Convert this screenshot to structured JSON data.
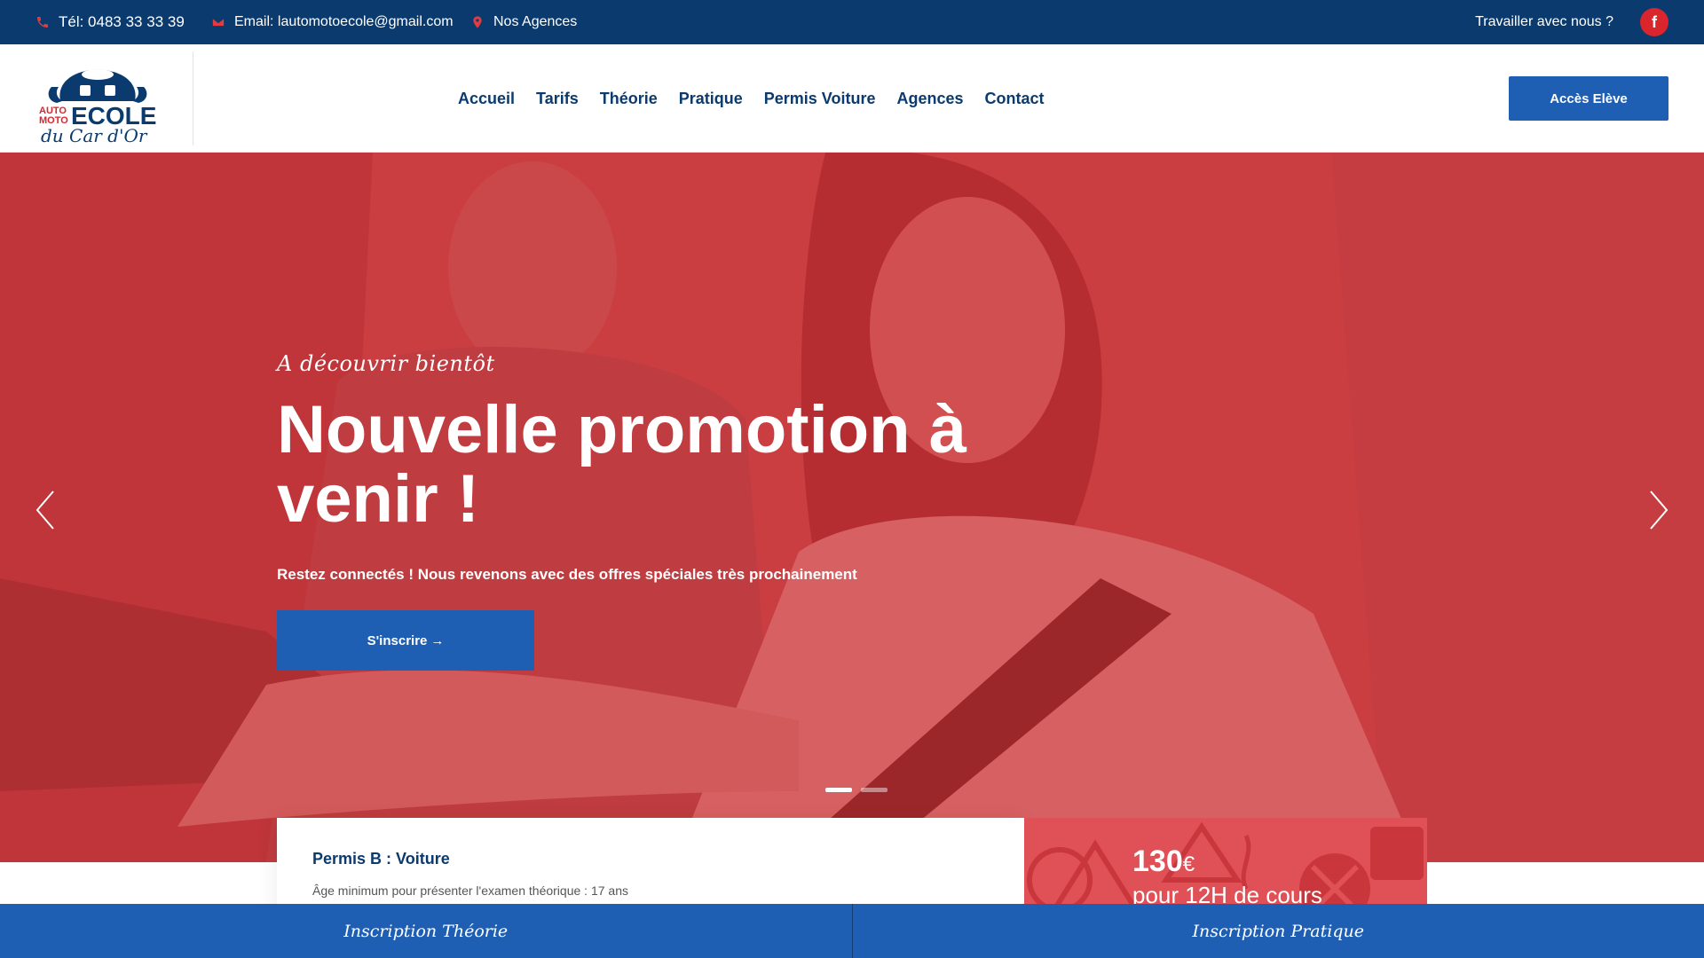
{
  "topbar": {
    "phone": "Tél: 0483 33 33 39",
    "email": "Email: lautomotoecole@gmail.com",
    "agencies": "Nos Agences",
    "work_with_us": "Travailler avec nous ?",
    "facebook_label": "f"
  },
  "logo": {
    "line1": "AUTO",
    "line2": "MOTO",
    "big": "ECOLE",
    "script": "du Car d'Or"
  },
  "nav": {
    "items": [
      "Accueil",
      "Tarifs",
      "Théorie",
      "Pratique",
      "Permis Voiture",
      "Agences",
      "Contact"
    ],
    "cta": "Accès Elève"
  },
  "hero": {
    "tagline": "A découvrir bientôt",
    "title": "Nouvelle promotion à venir !",
    "subtitle": "Restez connectés ! Nous revenons avec des offres spéciales très prochainement",
    "button": "S'inscrire",
    "button_arrow": "→",
    "slide_count": 2,
    "active_slide": 1
  },
  "card": {
    "title": "Permis B : Voiture",
    "text": "Âge minimum pour présenter l'examen théorique : 17 ans"
  },
  "price": {
    "amount": "130",
    "currency": "€",
    "detail": "pour 12H de cours"
  },
  "bottombar": {
    "left": "Inscription Théorie",
    "right": "Inscription Pratique"
  },
  "colors": {
    "navy": "#0b3a6e",
    "blue": "#1e5fb4",
    "red": "#d9252b",
    "hero_overlay": "#cd2d32"
  }
}
